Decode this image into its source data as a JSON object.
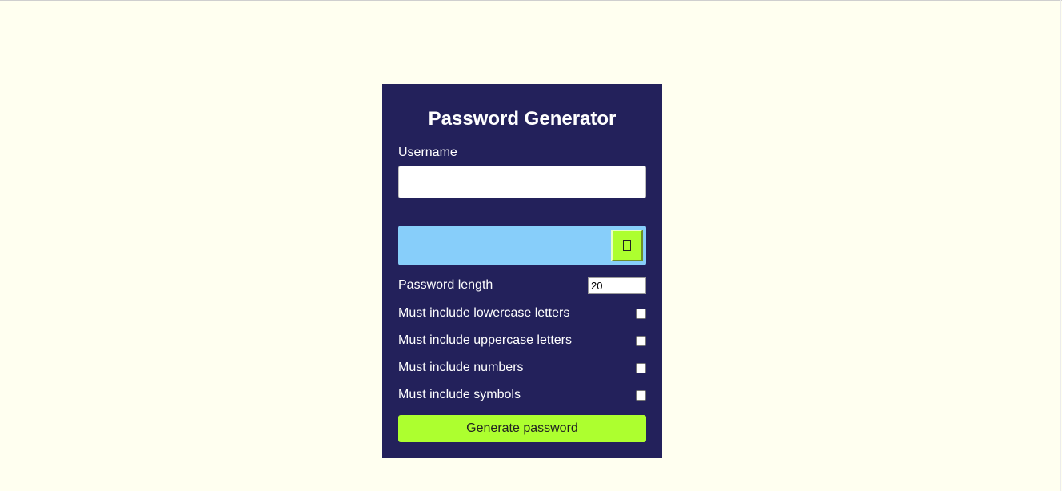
{
  "app": {
    "title": "Password Generator"
  },
  "username": {
    "label": "Username",
    "value": "",
    "placeholder": ""
  },
  "result": {
    "password": "",
    "copy_icon": "copy-icon"
  },
  "length": {
    "label": "Password length",
    "value": "20"
  },
  "options": [
    {
      "label": "Must include lowercase letters",
      "checked": false
    },
    {
      "label": "Must include uppercase letters",
      "checked": false
    },
    {
      "label": "Must include numbers",
      "checked": false
    },
    {
      "label": "Must include symbols",
      "checked": false
    }
  ],
  "actions": {
    "generate_label": "Generate password"
  },
  "colors": {
    "page_background": "#fffff0",
    "card_background": "#23215b",
    "result_background": "#87cefa",
    "accent": "#adff2f",
    "text_light": "#ffffff"
  }
}
